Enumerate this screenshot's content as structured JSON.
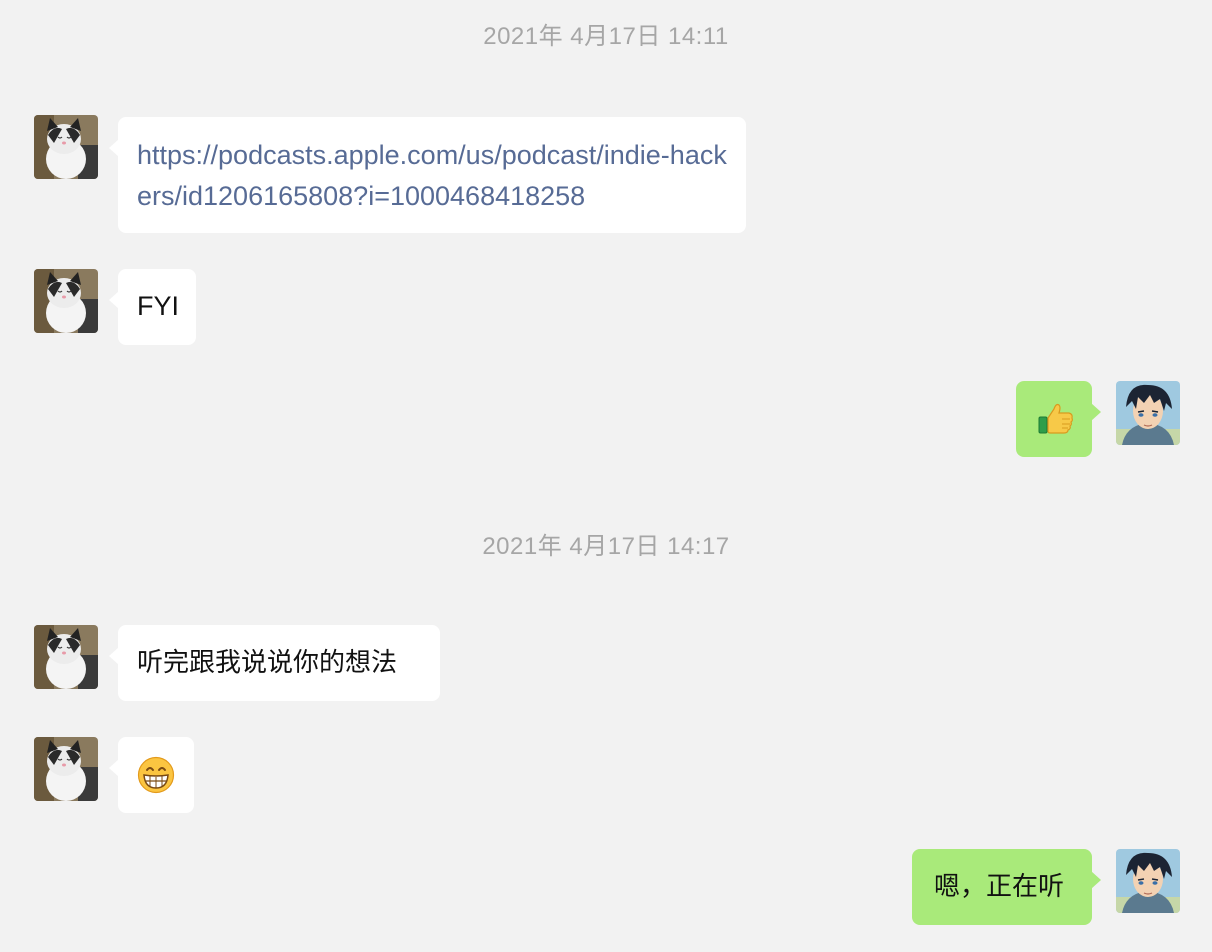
{
  "chat": {
    "timestamps": [
      "2021年 4月17日 14:11",
      "2021年 4月17日 14:17"
    ],
    "messages": [
      {
        "sender": "other",
        "kind": "link",
        "text": "https://podcasts.apple.com/us/podcast/indie-hackers/id1206165808?i=1000468418258"
      },
      {
        "sender": "other",
        "kind": "text",
        "text": "FYI"
      },
      {
        "sender": "me",
        "kind": "emoji",
        "text": "",
        "icon": "thumbs-up-icon"
      },
      {
        "sender": "other",
        "kind": "text",
        "text": "听完跟我说说你的想法"
      },
      {
        "sender": "other",
        "kind": "emoji",
        "text": "",
        "icon": "grinning-face-icon"
      },
      {
        "sender": "me",
        "kind": "text",
        "text": "嗯，正在听"
      }
    ]
  },
  "colors": {
    "background": "#f2f2f2",
    "incoming_bubble": "#ffffff",
    "outgoing_bubble": "#a9ea7a",
    "link": "#576b95",
    "timestamp": "#a6a6a6"
  }
}
